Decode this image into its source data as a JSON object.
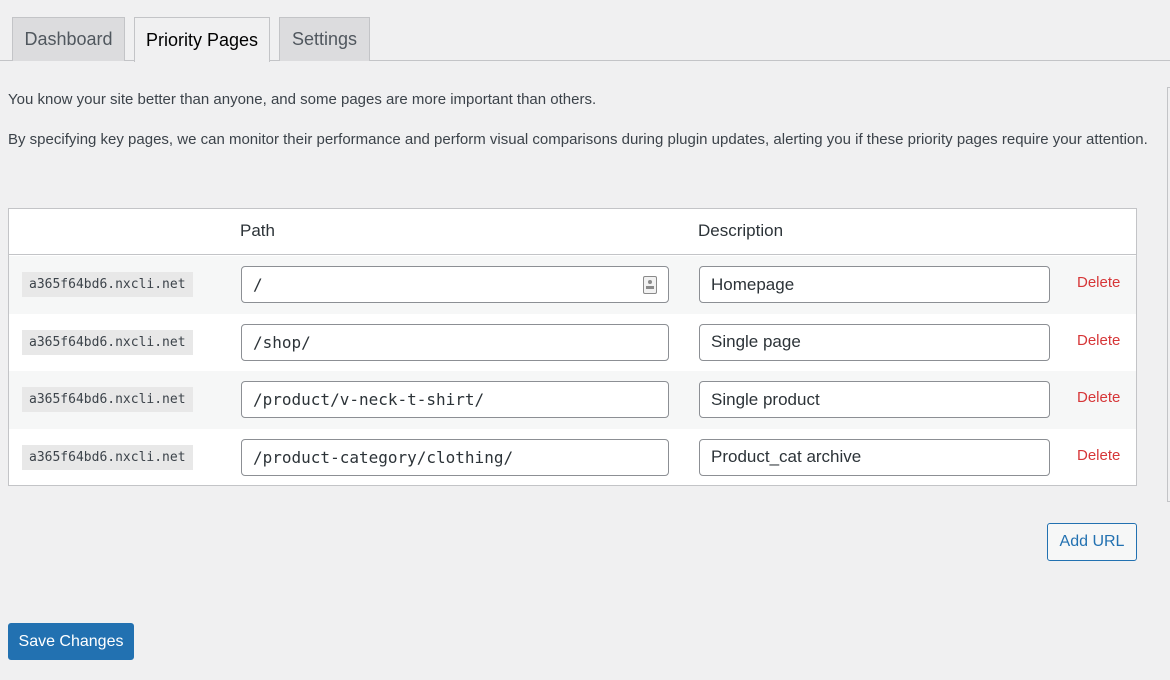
{
  "tabs": [
    {
      "label": "Dashboard",
      "active": false
    },
    {
      "label": "Priority Pages",
      "active": true
    },
    {
      "label": "Settings",
      "active": false
    }
  ],
  "intro": [
    "You know your site better than anyone, and some pages are more important than others.",
    "By specifying key pages, we can monitor their performance and perform visual comparisons during plugin updates, alerting you if these priority pages require your attention."
  ],
  "table": {
    "headers": {
      "domain": "",
      "path": "Path",
      "description": "Description"
    },
    "rows": [
      {
        "domain": "a365f64bd6.nxcli.net",
        "path": "/",
        "description": "Homepage",
        "action": "Delete"
      },
      {
        "domain": "a365f64bd6.nxcli.net",
        "path": "/shop/",
        "description": "Single page",
        "action": "Delete"
      },
      {
        "domain": "a365f64bd6.nxcli.net",
        "path": "/product/v-neck-t-shirt/",
        "description": "Single product",
        "action": "Delete"
      },
      {
        "domain": "a365f64bd6.nxcli.net",
        "path": "/product-category/clothing/",
        "description": "Product_cat archive",
        "action": "Delete"
      }
    ]
  },
  "buttons": {
    "add_url": "Add URL",
    "save": "Save Changes"
  },
  "colors": {
    "primary": "#2271b1",
    "danger": "#d63638",
    "background": "#f0f0f1"
  }
}
